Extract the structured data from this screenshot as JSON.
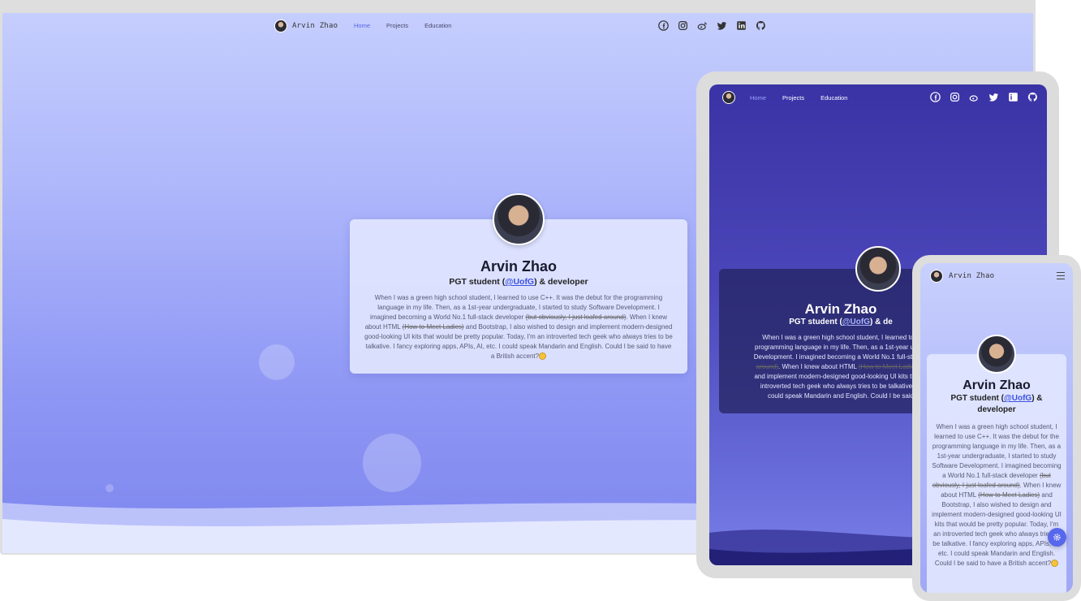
{
  "brand": {
    "name": "Arvin Zhao"
  },
  "nav": {
    "items": [
      {
        "label": "Home",
        "active": true
      },
      {
        "label": "Projects"
      },
      {
        "label": "Education"
      }
    ]
  },
  "social": [
    "facebook-icon",
    "instagram-icon",
    "weibo-icon",
    "twitter-icon",
    "linkedin-icon",
    "github-icon"
  ],
  "profile": {
    "name": "Arvin Zhao",
    "role_prefix": "PGT student (",
    "role_link": "@UofG",
    "role_suffix": ") & developer",
    "bio_1": "When I was a green high school student, I learned to use C++. It was the debut for the programming language in my life. Then, as a 1st-year undergraduate, I started to study Software Development. I imagined becoming a World No.1 full-stack developer ",
    "bio_strike_1": "(but obviously, I just loafed around)",
    "bio_2": ". When I knew about HTML ",
    "bio_strike_2": "(How to Meet Ladies)",
    "bio_3": " and Bootstrap, I also wished to design and implement modern-designed good-looking UI kits that would be pretty popular. Today, I'm an introverted tech geek who always tries to be talkative. I fancy exploring apps, APIs, AI, etc. I could speak Mandarin and English. Could I be said to have a British accent?"
  },
  "tablet": {
    "name": "Arvin Zhao",
    "role_prefix": "PGT student (",
    "role_link": "@UofG",
    "role_suffix": ") & de",
    "line_1": "When I was a green high school student, I learned to u",
    "line_2": "programming language in my life. Then, as a 1st-year under",
    "line_3": "Development. I imagined becoming a World No.1 full-stack d",
    "strike_1": "around)",
    "line_4a": ". When I knew about HTML ",
    "strike_2": "(How to Meet Ladies)",
    "line_4b": " a",
    "line_5": "and implement modern-designed good-looking UI kits that w",
    "line_6": "introverted tech geek who always tries to be talkative. I f",
    "line_7": "could speak Mandarin and English. Could I be said"
  },
  "colors": {
    "accent": "#5468e8",
    "link": "#3b52e0",
    "tablet_bg": "#3a33a6",
    "desktop_bg": "#b0b9fb"
  }
}
